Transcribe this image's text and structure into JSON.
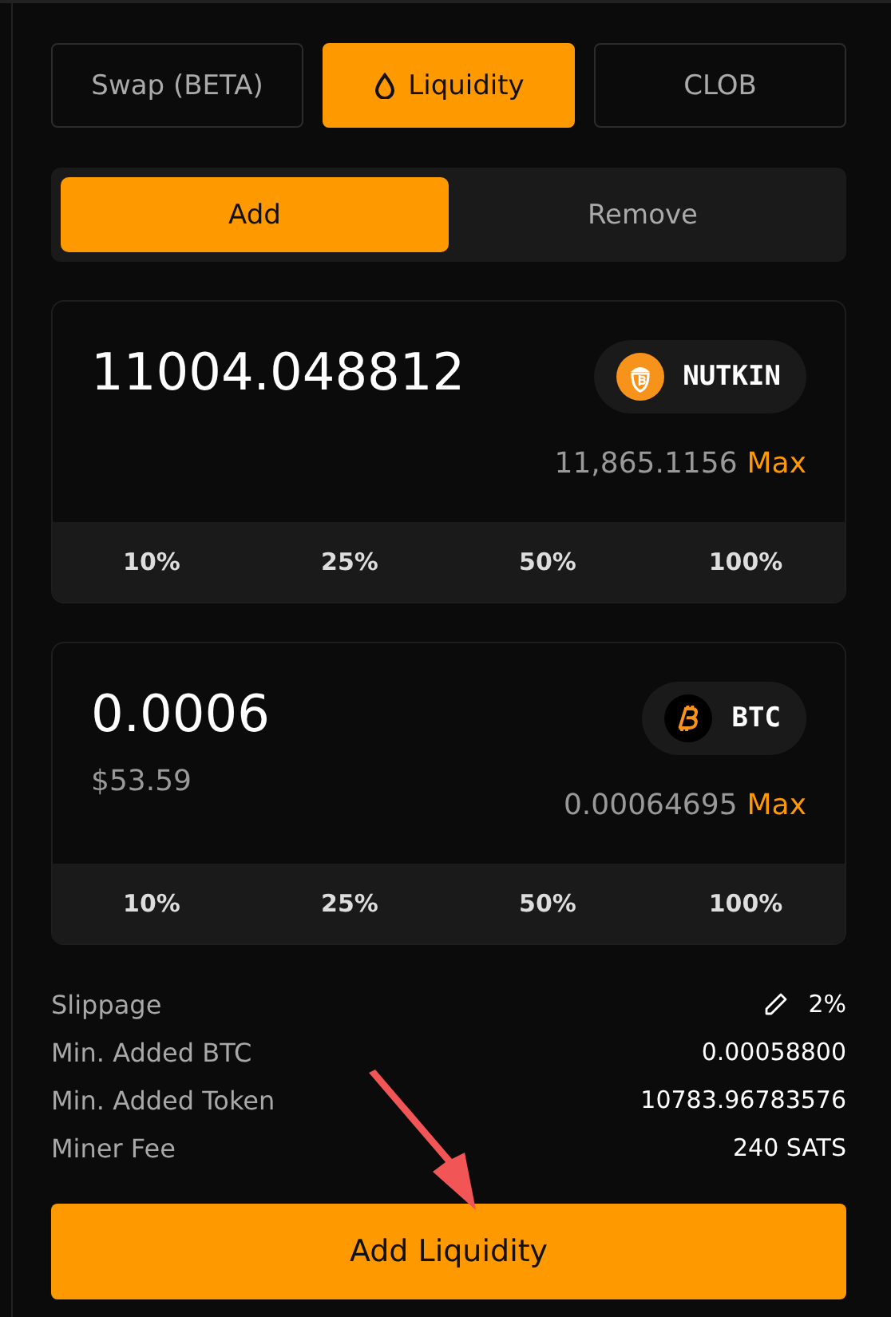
{
  "tabs": [
    {
      "label": "Swap (BETA)",
      "selected": false,
      "icon": false
    },
    {
      "label": "Liquidity",
      "selected": true,
      "icon": true
    },
    {
      "label": "CLOB",
      "selected": false,
      "icon": false
    }
  ],
  "mode": [
    {
      "label": "Add",
      "selected": true
    },
    {
      "label": "Remove",
      "selected": false
    }
  ],
  "cards": [
    {
      "amount": "11004.048812",
      "token": {
        "kind": "nutkin",
        "symbol": "NUTKIN"
      },
      "balance": "11,865.1156",
      "max": "Max",
      "percents": [
        "10%",
        "25%",
        "50%",
        "100%"
      ]
    },
    {
      "amount": "0.0006",
      "usd": "$53.59",
      "token": {
        "kind": "btc",
        "symbol": "BTC"
      },
      "balance": "0.00064695",
      "max": "Max",
      "percents": [
        "10%",
        "25%",
        "50%",
        "100%"
      ]
    }
  ],
  "details": [
    {
      "label": "Slippage",
      "value": "2%",
      "kind": "editable"
    },
    {
      "label": "Min. Added BTC",
      "value": "0.00058800",
      "kind": "plain"
    },
    {
      "label": "Min. Added Token",
      "value": "10783.96783576",
      "kind": "plain"
    },
    {
      "label": "Miner Fee",
      "value": "240 SATS",
      "kind": "plain"
    }
  ],
  "submit": "Add Liquidity"
}
